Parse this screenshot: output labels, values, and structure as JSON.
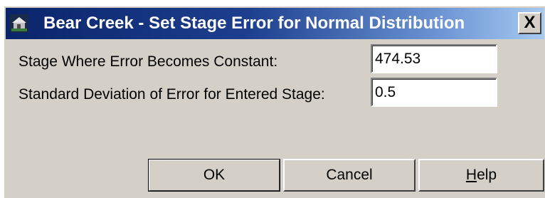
{
  "window": {
    "title": "Bear Creek - Set Stage Error for Normal Distribution",
    "close_label": "X",
    "icon": "app-icon"
  },
  "form": {
    "stage_label": "Stage Where Error Becomes Constant:",
    "stage_value": "474.53",
    "stddev_label": "Standard Deviation of Error for Entered Stage:",
    "stddev_value": "0.5"
  },
  "buttons": {
    "ok": "OK",
    "cancel": "Cancel",
    "help_hotkey": "H",
    "help_rest": "elp"
  },
  "colors": {
    "titlebar_start": "#0a246a",
    "titlebar_end": "#a6caf0",
    "dialog_face": "#d4d0c8"
  }
}
